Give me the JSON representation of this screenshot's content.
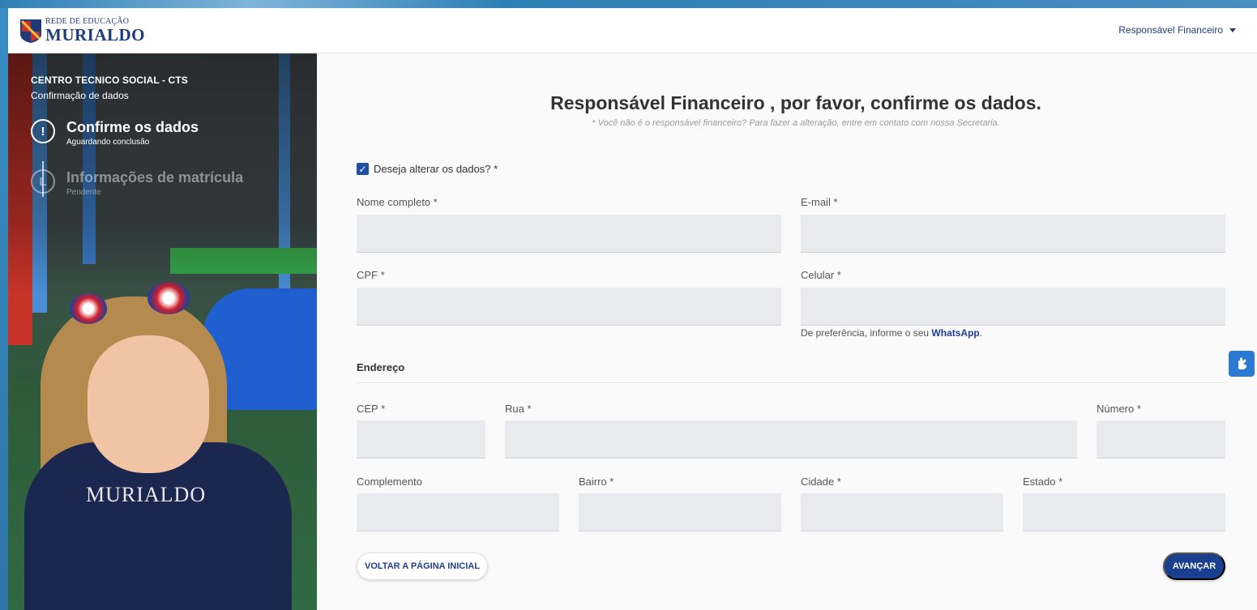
{
  "header": {
    "logo_line1": "REDE DE EDUCAÇÃO",
    "logo_line2": "MURIALDO",
    "user_menu_label": "Responsável Financeiro"
  },
  "sidebar": {
    "school_name": "CENTRO TECNICO SOCIAL - CTS",
    "page_subtitle": "Confirmação de dados",
    "photo_shirt_text": "MURIALDO",
    "steps": [
      {
        "icon": "!",
        "title": "Confirme os dados",
        "status": "Aguardando conclusão"
      },
      {
        "icon": "L",
        "title": "Informações de matrícula",
        "status": "Pendente"
      }
    ]
  },
  "form": {
    "title": "Responsável Financeiro , por favor, confirme os dados.",
    "note": "* Você não é o responsável financeiro? Para fazer a alteração, entre em contato com nossa Secretaria.",
    "change_data_label": "Deseja alterar os dados? *",
    "change_data_checked": true,
    "fields": {
      "full_name": {
        "label": "Nome completo *",
        "value": ""
      },
      "email": {
        "label": "E-mail *",
        "value": ""
      },
      "cpf": {
        "label": "CPF *",
        "value": ""
      },
      "cellphone": {
        "label": "Celular *",
        "value": ""
      },
      "cep": {
        "label": "CEP *",
        "value": ""
      },
      "street": {
        "label": "Rua *",
        "value": ""
      },
      "number": {
        "label": "Número *",
        "value": ""
      },
      "complement": {
        "label": "Complemento",
        "value": ""
      },
      "neighborhood": {
        "label": "Bairro *",
        "value": ""
      },
      "city": {
        "label": "Cidade *",
        "value": ""
      },
      "state": {
        "label": "Estado *",
        "value": ""
      }
    },
    "cellphone_hint_prefix": "De preferência, informe o seu ",
    "cellphone_hint_bold": "WhatsApp",
    "cellphone_hint_suffix": ".",
    "address_section_title": "Endereço",
    "back_button": "VOLTAR A PÁGINA INICIAL",
    "next_button": "AVANÇAR"
  },
  "colors": {
    "primary": "#1a3f8f",
    "input_bg": "#e8eaee",
    "panel_bg": "#fafafa",
    "accessibility": "#2a7ad4"
  },
  "icons": {
    "accessibility": "hand-sign-icon",
    "user_menu": "caret-down-icon",
    "checkbox": "check-icon"
  }
}
